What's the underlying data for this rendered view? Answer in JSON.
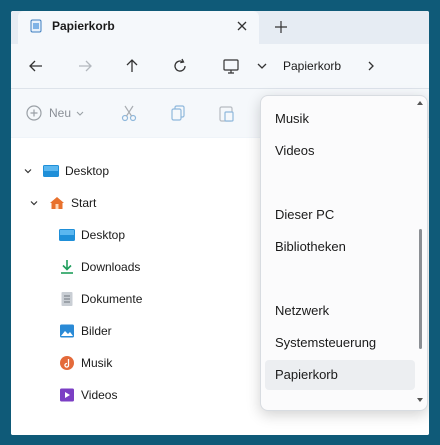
{
  "tab": {
    "title": "Papierkorb"
  },
  "address": {
    "current": "Papierkorb"
  },
  "commandbar": {
    "new_label": "Neu"
  },
  "tree": [
    {
      "label": "Desktop",
      "icon": "desktop-icon"
    },
    {
      "label": "Start",
      "icon": "home-icon"
    },
    {
      "label": "Desktop",
      "icon": "desktop-icon"
    },
    {
      "label": "Downloads",
      "icon": "download-icon"
    },
    {
      "label": "Dokumente",
      "icon": "document-icon"
    },
    {
      "label": "Bilder",
      "icon": "pictures-icon"
    },
    {
      "label": "Musik",
      "icon": "music-icon"
    },
    {
      "label": "Videos",
      "icon": "video-icon"
    }
  ],
  "dropdown": {
    "items": [
      {
        "label": "Musik"
      },
      {
        "label": "Videos"
      },
      {
        "label": "Dieser PC"
      },
      {
        "label": "Bibliotheken"
      },
      {
        "label": "Netzwerk"
      },
      {
        "label": "Systemsteuerung"
      },
      {
        "label": "Papierkorb",
        "selected": true
      }
    ]
  },
  "colors": {
    "accent": "#0f5a78",
    "folder_blue": "#1f8fd8",
    "home_orange": "#e8712d"
  }
}
